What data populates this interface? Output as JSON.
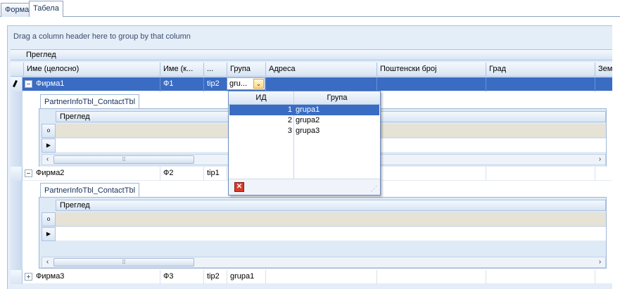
{
  "tabs": [
    {
      "label": "Форма"
    },
    {
      "label": "Табела"
    }
  ],
  "group_panel_text": "Drag a column header here to group by that column",
  "band": "Преглед",
  "columns": [
    "Име (целосно)",
    "Име (к...",
    "...",
    "Група",
    "Адреса",
    "Поштенски број",
    "Град",
    "Зем"
  ],
  "rows": [
    {
      "name": "Фирма1",
      "short": "Ф1",
      "type": "tip2",
      "group": "gru..."
    },
    {
      "name": "Фирма2",
      "short": "Ф2",
      "type": "tip1",
      "group": ""
    },
    {
      "name": "Фирма3",
      "short": "Ф3",
      "type": "tip2",
      "group": "grupa1"
    }
  ],
  "detail": {
    "tab_label": "PartnerInfoTbl_ContactTbl",
    "band": "Преглед"
  },
  "popup": {
    "headers": [
      "ИД",
      "Група"
    ],
    "rows": [
      {
        "id": "1",
        "name": "grupa1"
      },
      {
        "id": "2",
        "name": "grupa2"
      },
      {
        "id": "3",
        "name": "grupa3"
      }
    ]
  },
  "icons": {
    "search": "search-icon",
    "next": "play-icon",
    "close": "close-icon"
  }
}
